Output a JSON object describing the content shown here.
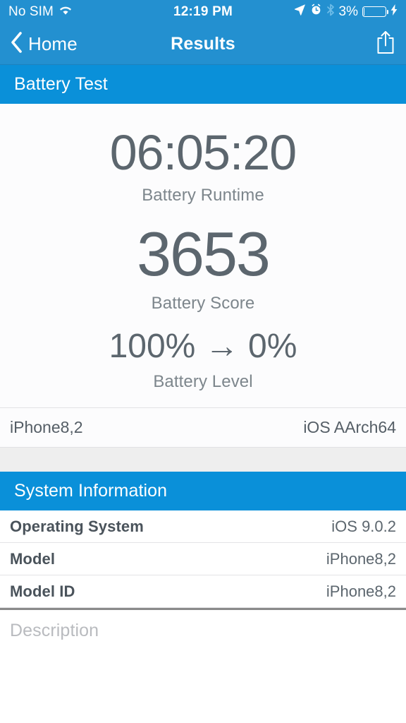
{
  "status_bar": {
    "carrier": "No SIM",
    "wifi_icon": "wifi-icon",
    "time": "12:19 PM",
    "location_icon": "location-arrow-icon",
    "alarm_icon": "alarm-clock-icon",
    "bluetooth_icon": "bluetooth-icon",
    "battery_percent": "3%",
    "battery_level": 3,
    "battery_icon": "battery-icon",
    "charging_icon": "lightning-bolt-icon"
  },
  "nav_bar": {
    "back_icon": "chevron-left-icon",
    "back_label": "Home",
    "title": "Results",
    "share_icon": "share-icon"
  },
  "battery_test": {
    "section_title": "Battery Test",
    "metrics": [
      {
        "value": "06:05:20",
        "label": "Battery Runtime"
      },
      {
        "value": "3653",
        "label": "Battery Score"
      },
      {
        "value": "100% → 0%",
        "label": "Battery Level"
      }
    ],
    "device_row": {
      "left": "iPhone8,2",
      "right": "iOS AArch64"
    }
  },
  "system_information": {
    "section_title": "System Information",
    "rows": [
      {
        "label": "Operating System",
        "value": "iOS 9.0.2"
      },
      {
        "label": "Model",
        "value": "iPhone8,2"
      },
      {
        "label": "Model ID",
        "value": "iPhone8,2"
      }
    ]
  },
  "description": {
    "placeholder": "Description",
    "value": ""
  },
  "colors": {
    "status_bar_blue": "#2390d0",
    "nav_bar_blue": "#2390d0",
    "section_header_blue": "#0a90d9",
    "metric_text": "#5c666e",
    "metric_label": "#7d868c",
    "gap_grey": "#eeeeee"
  }
}
